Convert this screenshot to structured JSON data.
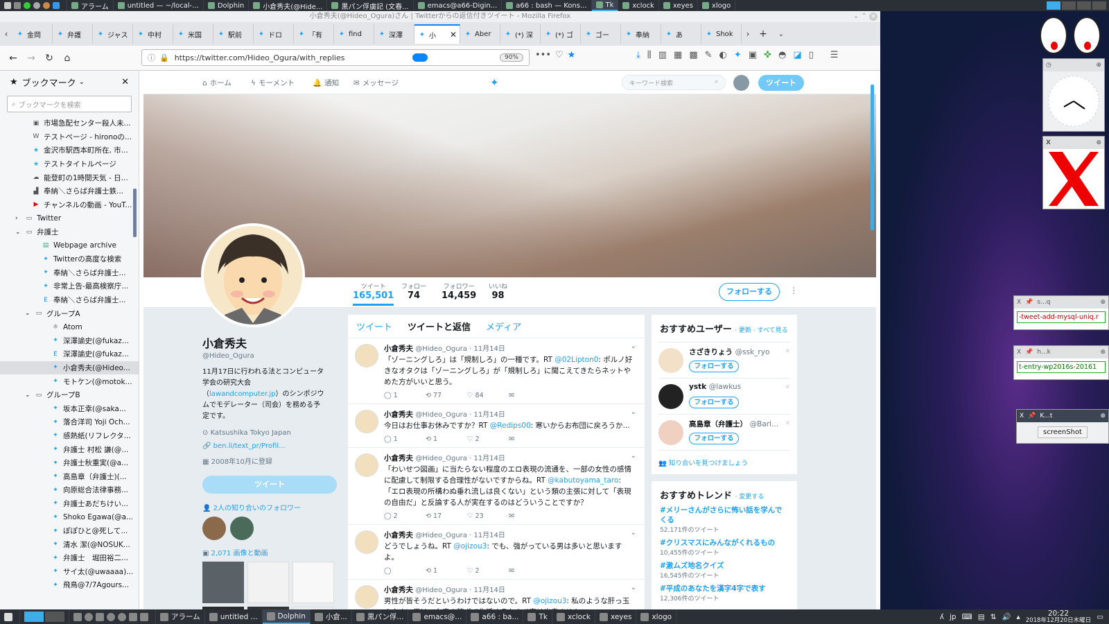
{
  "top_panel": {
    "tasks": [
      {
        "label": "アラーム",
        "active": false
      },
      {
        "label": "untitled — ~/local-...",
        "active": false
      },
      {
        "label": "Dolphin",
        "active": false
      },
      {
        "label": "小倉秀夫(@Hide...",
        "active": false
      },
      {
        "label": "黒パン俘虜記 (文春...",
        "active": false
      },
      {
        "label": "emacs@a66-Digin...",
        "active": false
      },
      {
        "label": "a66 : bash — Kons...",
        "active": false
      },
      {
        "label": "Tk",
        "active": true
      },
      {
        "label": "xclock",
        "active": false
      },
      {
        "label": "xeyes",
        "active": false
      },
      {
        "label": "xlogo",
        "active": false
      }
    ]
  },
  "firefox": {
    "window_title": "小倉秀夫(@Hideo_Ogura)さん | Twitterからの返信付きツイート - Mozilla Firefox",
    "tabs": [
      "金岡",
      "弁護",
      "ジャス",
      "中村",
      "米国",
      "駅前",
      "ドロ",
      "「有",
      "find",
      "深澤",
      "小",
      "Aber",
      "(*) 深",
      "(*) ゴ",
      "ゴー",
      "奉納",
      "あ",
      "Shok"
    ],
    "url": "https://twitter.com/Hideo_Ogura/with_replies",
    "zoom": "90%"
  },
  "sidebar": {
    "title": "ブックマーク",
    "search_placeholder": "ブックマークを検索",
    "items": [
      {
        "label": "市場急配センター殺人未...",
        "indent": 0,
        "icon": "page-icon"
      },
      {
        "label": "テストページ - hironoの...",
        "indent": 0,
        "icon": "wiki-icon"
      },
      {
        "label": "金沢市駅西本町所在, 市...",
        "indent": 0,
        "icon": "star-icon"
      },
      {
        "label": "テストタイトルページ",
        "indent": 0,
        "icon": "star-icon"
      },
      {
        "label": "能登町の1時間天気 - 日...",
        "indent": 0,
        "icon": "weather-icon"
      },
      {
        "label": "奉納＼さらば弁護士鉄...",
        "indent": 0,
        "icon": "chart-icon"
      },
      {
        "label": "チャンネルの動画 - YouT...",
        "indent": 0,
        "icon": "youtube-icon"
      },
      {
        "label": "Twitter",
        "indent": 0,
        "icon": "folder-icon",
        "folder": "closed"
      },
      {
        "label": "弁護士",
        "indent": 0,
        "icon": "folder-icon",
        "folder": "open"
      },
      {
        "label": "Webpage archive",
        "indent": 1,
        "icon": "archive-icon"
      },
      {
        "label": "Twitterの高度な検索",
        "indent": 1,
        "icon": "twitter-icon"
      },
      {
        "label": "奉納＼さらば弁護士...",
        "indent": 1,
        "icon": "twitter-icon"
      },
      {
        "label": "非常上告-最高検察庁...",
        "indent": 1,
        "icon": "twitter-icon"
      },
      {
        "label": "奉納＼さらば弁護士...",
        "indent": 1,
        "icon": "blog-icon"
      },
      {
        "label": "グループA",
        "indent": 1,
        "icon": "folder-icon",
        "folder": "open"
      },
      {
        "label": "Atom",
        "indent": 2,
        "icon": "atom-icon"
      },
      {
        "label": "深澤諭史(@fukaz...",
        "indent": 2,
        "icon": "twitter-icon"
      },
      {
        "label": "深澤諭史(@fukaz...",
        "indent": 2,
        "icon": "blog-icon"
      },
      {
        "label": "小倉秀夫(@Hideo...",
        "indent": 2,
        "icon": "twitter-icon",
        "selected": true
      },
      {
        "label": "モトケン(@motok...",
        "indent": 2,
        "icon": "twitter-icon"
      },
      {
        "label": "グループB",
        "indent": 1,
        "icon": "folder-icon",
        "folder": "open"
      },
      {
        "label": "坂本正幸(@saka...",
        "indent": 2,
        "icon": "twitter-icon"
      },
      {
        "label": "落合洋司 Yoji Och...",
        "indent": 2,
        "icon": "twitter-icon"
      },
      {
        "label": "感熱紙(リフレクタ...",
        "indent": 2,
        "icon": "twitter-icon"
      },
      {
        "label": "弁護士 村松 謙(@...",
        "indent": 2,
        "icon": "twitter-icon"
      },
      {
        "label": "弁護士秋重実(@a...",
        "indent": 2,
        "icon": "twitter-icon"
      },
      {
        "label": "高島章（弁護士)(...",
        "indent": 2,
        "icon": "twitter-icon"
      },
      {
        "label": "向原総合法律事務...",
        "indent": 2,
        "icon": "twitter-icon"
      },
      {
        "label": "弁護士あだちけい...",
        "indent": 2,
        "icon": "twitter-icon"
      },
      {
        "label": "Shoko Egawa(@a...",
        "indent": 2,
        "icon": "twitter-icon"
      },
      {
        "label": "ぽぽひと@死して...",
        "indent": 2,
        "icon": "twitter-icon"
      },
      {
        "label": "清水 潔(@NOSUK...",
        "indent": 2,
        "icon": "twitter-icon"
      },
      {
        "label": "弁護士　堀田裕二...",
        "indent": 2,
        "icon": "twitter-icon"
      },
      {
        "label": "サイ太(@uwaaaa)...",
        "indent": 2,
        "icon": "twitter-icon"
      },
      {
        "label": "飛鳥@7/7Agours...",
        "indent": 2,
        "icon": "twitter-icon"
      }
    ]
  },
  "twitter": {
    "nav": {
      "home": "ホーム",
      "moments": "モーメント",
      "notifications": "通知",
      "messages": "メッセージ",
      "search_placeholder": "キーワード検索",
      "tweet_button": "ツイート"
    },
    "stats": [
      {
        "label": "ツイート",
        "value": "165,501",
        "active": true
      },
      {
        "label": "フォロー",
        "value": "74",
        "active": false
      },
      {
        "label": "フォロワー",
        "value": "14,459",
        "active": false
      },
      {
        "label": "いいね",
        "value": "98",
        "active": false
      }
    ],
    "follow_button": "フォローする",
    "profile": {
      "name": "小倉秀夫",
      "handle": "@Hideo_Ogura",
      "bio_pre": "11月17日に行われる法とコンピュータ学会の研究大会（",
      "bio_link": "lawandcomputer.jp",
      "bio_post": "）のシンポジウムでモデレーター（司会）を務める予定です。",
      "location": "Katsushika Tokyo Japan",
      "url": "ben.li/text_pr/Profil...",
      "joined": "2008年10月に登録",
      "tweet_button": "ツイート",
      "followers_you_know": "2人の知り合いのフォロワー",
      "media_count": "2,071 画像と動画"
    },
    "timeline_tabs": {
      "tweets": "ツイート",
      "replies": "ツイートと返信",
      "media": "メディア"
    },
    "tweets": [
      {
        "name": "小倉秀夫",
        "handle": "@Hideo_Ogura",
        "date": "11月14日",
        "pre": "「ゾーニングしろ」は「規制しろ」の一種です。RT ",
        "mention": "@02Lipton0",
        "post": ": ポルノ好きなオタクは「ゾーニングしろ」が「規制しろ」に聞こえてきたらネットやめた方がいいと思う。",
        "replies": "1",
        "retweets": "77",
        "likes": "84"
      },
      {
        "name": "小倉秀夫",
        "handle": "@Hideo_Ogura",
        "date": "11月14日",
        "pre": "今日はお仕事お休みですか？RT ",
        "mention": "@Redips00",
        "post": ": 寒いからお布団に戻ろうか...",
        "replies": "1",
        "retweets": "1",
        "likes": "2"
      },
      {
        "name": "小倉秀夫",
        "handle": "@Hideo_Ogura",
        "date": "11月14日",
        "pre": "「わいせつ図画」に当たらない程度のエロ表現の流通を、一部の女性の感情に配慮して制限する合理性がないですからね。RT ",
        "mention": "@kabutoyama_taro",
        "post": ": 「エロ表現の所構わぬ垂れ流しは良くない」という類の主張に対して「表現の自由だ」と反論する人が実在するのはどういうことですか？",
        "replies": "2",
        "retweets": "17",
        "likes": "23"
      },
      {
        "name": "小倉秀夫",
        "handle": "@Hideo_Ogura",
        "date": "11月14日",
        "pre": "どうでしょうね。RT ",
        "mention": "@ojizou3",
        "post": ": でも、強がっている男は多いと思いますよ。",
        "replies": "",
        "retweets": "1",
        "likes": "2"
      },
      {
        "name": "小倉秀夫",
        "handle": "@Hideo_Ogura",
        "date": "11月14日",
        "pre": "男性が皆そうだというわけではないので。RT ",
        "mention": "@ojizou3",
        "post": ": 私のような肝っ玉の小さい男は、女房の稼ぎで生活するなんて事は出来ません...",
        "replies": "",
        "retweets": "",
        "likes": ""
      }
    ],
    "recommended": {
      "title": "おすすめユーザー",
      "links": "· 更新 · すべて見る",
      "users": [
        {
          "name": "さざきりょう",
          "handle": "@ssk_ryo",
          "button": "フォローする"
        },
        {
          "name": "ystk",
          "handle": "@lawkus",
          "button": "フォローする"
        },
        {
          "name": "高島章（弁護士）",
          "handle": "@Barl...",
          "button": "フォローする"
        }
      ],
      "find_friends": "知り合いを見つけましょう"
    },
    "trends": {
      "title": "おすすめトレンド",
      "change": "· 変更する",
      "items": [
        {
          "name": "#メリーさんがさらに怖い話を学んでくる",
          "count": "52,171件のツイート"
        },
        {
          "name": "#クリスマスにみんながくれるもの",
          "count": "10,455件のツイート"
        },
        {
          "name": "#激ムズ地名クイズ",
          "count": "16,545件のツイート"
        },
        {
          "name": "#平成のあなたを漢字4字で表す",
          "count": "12,306件のツイート"
        }
      ]
    }
  },
  "desktop": {
    "widget1_url": "-tweet-add-mysql-uniq.r",
    "widget2_url": "t-entry-wp2016s-20161",
    "widget1_title": "s...q",
    "widget2_title": "h...k",
    "widget3_title": "K...t",
    "screenshot_button": "screenShot"
  },
  "bottom_panel": {
    "tasks": [
      {
        "label": "アラーム"
      },
      {
        "label": "untitled ..."
      },
      {
        "label": "Dolphin",
        "active": true
      },
      {
        "label": "小倉..."
      },
      {
        "label": "黒パン俘..."
      },
      {
        "label": "emacs@..."
      },
      {
        "label": "a66 : ba..."
      },
      {
        "label": "Tk"
      },
      {
        "label": "xclock"
      },
      {
        "label": "xeyes"
      },
      {
        "label": "xlogo"
      }
    ],
    "ime": "jp",
    "time": "20:22",
    "date": "2018年12月20日木曜日"
  }
}
